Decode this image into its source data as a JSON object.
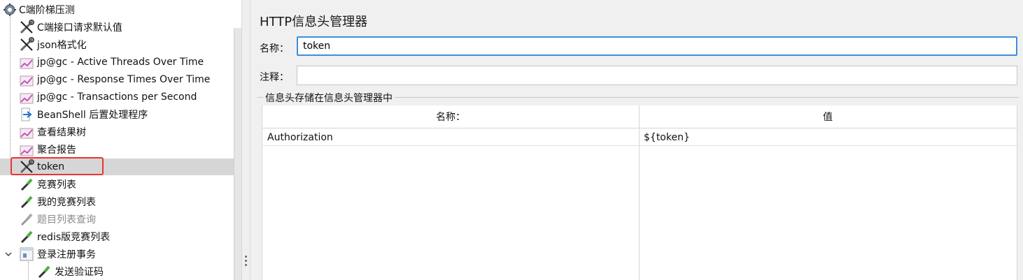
{
  "tree": {
    "root": {
      "label": "C端阶梯压测",
      "icon": "gear-icon"
    },
    "items": [
      {
        "label": "C端接口请求默认值",
        "icon": "wrench-icon"
      },
      {
        "label": "json格式化",
        "icon": "wrench-icon"
      },
      {
        "label": "jp@gc - Active Threads Over Time",
        "icon": "graph-icon"
      },
      {
        "label": "jp@gc - Response Times Over Time",
        "icon": "graph-icon"
      },
      {
        "label": "jp@gc - Transactions per Second",
        "icon": "graph-icon"
      },
      {
        "label": "BeanShell 后置处理程序",
        "icon": "arrow-icon"
      },
      {
        "label": "查看结果树",
        "icon": "graph-icon"
      },
      {
        "label": "聚合报告",
        "icon": "graph-icon"
      },
      {
        "label": "token",
        "icon": "wrench-icon"
      },
      {
        "label": "竞赛列表",
        "icon": "pipette-icon"
      },
      {
        "label": "我的竞赛列表",
        "icon": "pipette-icon"
      },
      {
        "label": "题目列表查询",
        "icon": "pipette-icon"
      },
      {
        "label": "redis版竞赛列表",
        "icon": "pipette-icon"
      },
      {
        "label": "登录注册事务",
        "icon": "controller-icon"
      },
      {
        "label": "发送验证码",
        "icon": "pipette-icon"
      }
    ]
  },
  "panel": {
    "title": "HTTP信息头管理器",
    "name_label": "名称：",
    "name_value": "token",
    "comment_label": "注释：",
    "comment_value": "",
    "group_title": "信息头存储在信息头管理器中",
    "table": {
      "headers": [
        "名称：",
        "值"
      ],
      "rows": [
        [
          "Authorization",
          "${token}"
        ]
      ]
    }
  },
  "colors": {
    "selection_outline": "#e33333",
    "focus_border": "#3d8ee0"
  }
}
